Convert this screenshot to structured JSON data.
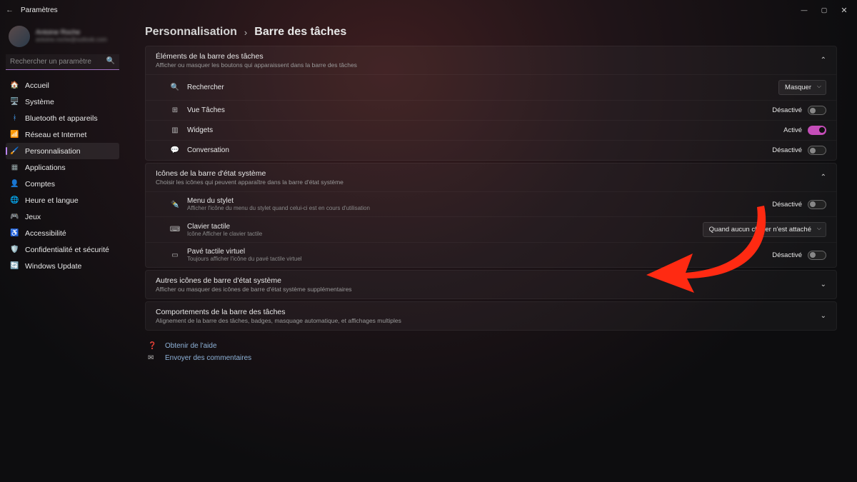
{
  "window": {
    "title": "Paramètres"
  },
  "user": {
    "name": "Antoine Roche",
    "email": "antoine.roche@outlook.com"
  },
  "search": {
    "placeholder": "Rechercher un paramètre"
  },
  "nav": [
    {
      "icon": "🏠",
      "label": "Accueil"
    },
    {
      "icon": "🖥️",
      "label": "Système"
    },
    {
      "icon": "ᚼ",
      "label": "Bluetooth et appareils",
      "iconColor": "#4aa8ff"
    },
    {
      "icon": "📶",
      "label": "Réseau et Internet"
    },
    {
      "icon": "🖌️",
      "label": "Personnalisation",
      "active": true
    },
    {
      "icon": "▦",
      "label": "Applications",
      "iconColor": "#9aa"
    },
    {
      "icon": "👤",
      "label": "Comptes"
    },
    {
      "icon": "🌐",
      "label": "Heure et langue"
    },
    {
      "icon": "🎮",
      "label": "Jeux"
    },
    {
      "icon": "♿",
      "label": "Accessibilité"
    },
    {
      "icon": "🛡️",
      "label": "Confidentialité et sécurité"
    },
    {
      "icon": "🔄",
      "label": "Windows Update"
    }
  ],
  "breadcrumb": {
    "parent": "Personnalisation",
    "current": "Barre des tâches"
  },
  "sections": {
    "elements": {
      "title": "Éléments de la barre des tâches",
      "subtitle": "Afficher ou masquer les boutons qui apparaissent dans la barre des tâches",
      "rows": [
        {
          "icon": "🔍",
          "label": "Rechercher",
          "control": "dropdown",
          "value": "Masquer"
        },
        {
          "icon": "⊞",
          "label": "Vue Tâches",
          "control": "toggle",
          "state": "Désactivé"
        },
        {
          "icon": "▥",
          "label": "Widgets",
          "control": "toggle",
          "state": "Activé"
        },
        {
          "icon": "💬",
          "label": "Conversation",
          "control": "toggle",
          "state": "Désactivé"
        }
      ]
    },
    "tray": {
      "title": "Icônes de la barre d'état système",
      "subtitle": "Choisir les icônes qui peuvent apparaître dans la barre d'état système",
      "rows": [
        {
          "icon": "✒️",
          "label": "Menu du stylet",
          "sub": "Afficher l'icône du menu du stylet quand celui-ci est en cours d'utilisation",
          "control": "toggle",
          "state": "Désactivé"
        },
        {
          "icon": "⌨",
          "label": "Clavier tactile",
          "sub": "Icône Afficher le clavier tactile",
          "control": "dropdown",
          "value": "Quand aucun clavier n'est attaché"
        },
        {
          "icon": "▭",
          "label": "Pavé tactile virtuel",
          "sub": "Toujours afficher l'icône du pavé tactile virtuel",
          "control": "toggle",
          "state": "Désactivé"
        }
      ]
    },
    "other": {
      "title": "Autres icônes de barre d'état système",
      "subtitle": "Afficher ou masquer des icônes de barre d'état système supplémentaires"
    },
    "behaviors": {
      "title": "Comportements de la barre des tâches",
      "subtitle": "Alignement de la barre des tâches, badges, masquage automatique, et affichages multiples"
    }
  },
  "links": {
    "help": "Obtenir de l'aide",
    "feedback": "Envoyer des commentaires"
  }
}
